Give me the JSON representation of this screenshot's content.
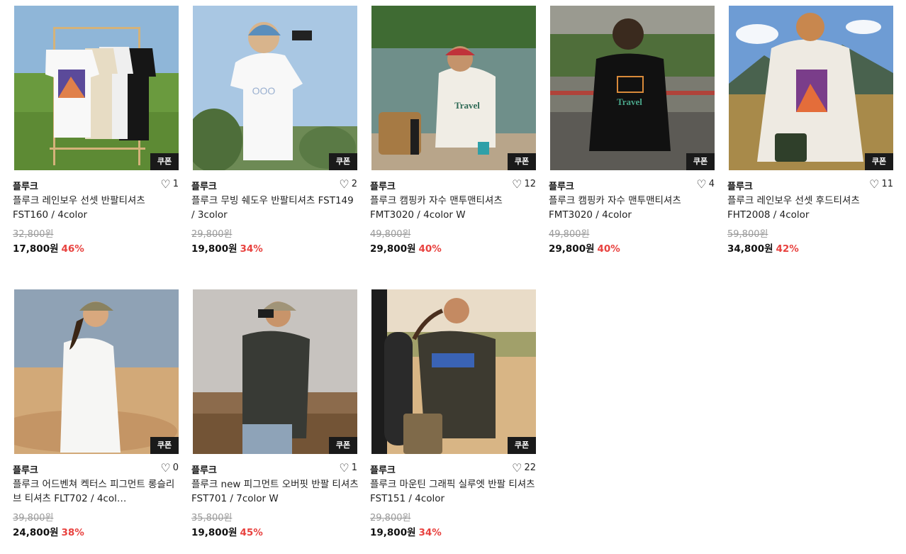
{
  "coupon_label": "쿠폰",
  "currency": "원",
  "colors": {
    "discount": "#e8423f",
    "coupon_bg": "#1a1a1a"
  },
  "products": [
    {
      "brand": "플루크",
      "likes": "1",
      "name": "플루크 레인보우 선셋 반팔티셔츠 FST160 / 4color",
      "original_price": "32,800원",
      "price": "17,800원",
      "discount": "46%"
    },
    {
      "brand": "플루크",
      "likes": "2",
      "name": "플루크 무빙 쉐도우 반팔티셔츠 FST149 / 3color",
      "original_price": "29,800원",
      "price": "19,800원",
      "discount": "34%"
    },
    {
      "brand": "플루크",
      "likes": "12",
      "name": "플루크 캠핑카 자수 맨투맨티셔츠 FMT3020 / 4color W",
      "original_price": "49,800원",
      "price": "29,800원",
      "discount": "40%"
    },
    {
      "brand": "플루크",
      "likes": "4",
      "name": "플루크 캠핑카 자수 맨투맨티셔츠 FMT3020 / 4color",
      "original_price": "49,800원",
      "price": "29,800원",
      "discount": "40%"
    },
    {
      "brand": "플루크",
      "likes": "11",
      "name": "플루크 레인보우 선셋 후드티셔츠 FHT2008 / 4color",
      "original_price": "59,800원",
      "price": "34,800원",
      "discount": "42%"
    },
    {
      "brand": "플루크",
      "likes": "0",
      "name": "플루크 어드벤쳐 켁터스 피그먼트 롱슬리브 티셔츠 FLT702 / 4col…",
      "original_price": "39,800원",
      "price": "24,800원",
      "discount": "38%"
    },
    {
      "brand": "플루크",
      "likes": "1",
      "name": "플루크 new 피그먼트 오버핏 반팔 티셔츠 FST701 / 7color W",
      "original_price": "35,800원",
      "price": "19,800원",
      "discount": "45%"
    },
    {
      "brand": "플루크",
      "likes": "22",
      "name": "플루크 마운틴 그래픽 실루엣 반팔 티셔츠 FST151 / 4color",
      "original_price": "29,800원",
      "price": "19,800원",
      "discount": "34%"
    }
  ]
}
